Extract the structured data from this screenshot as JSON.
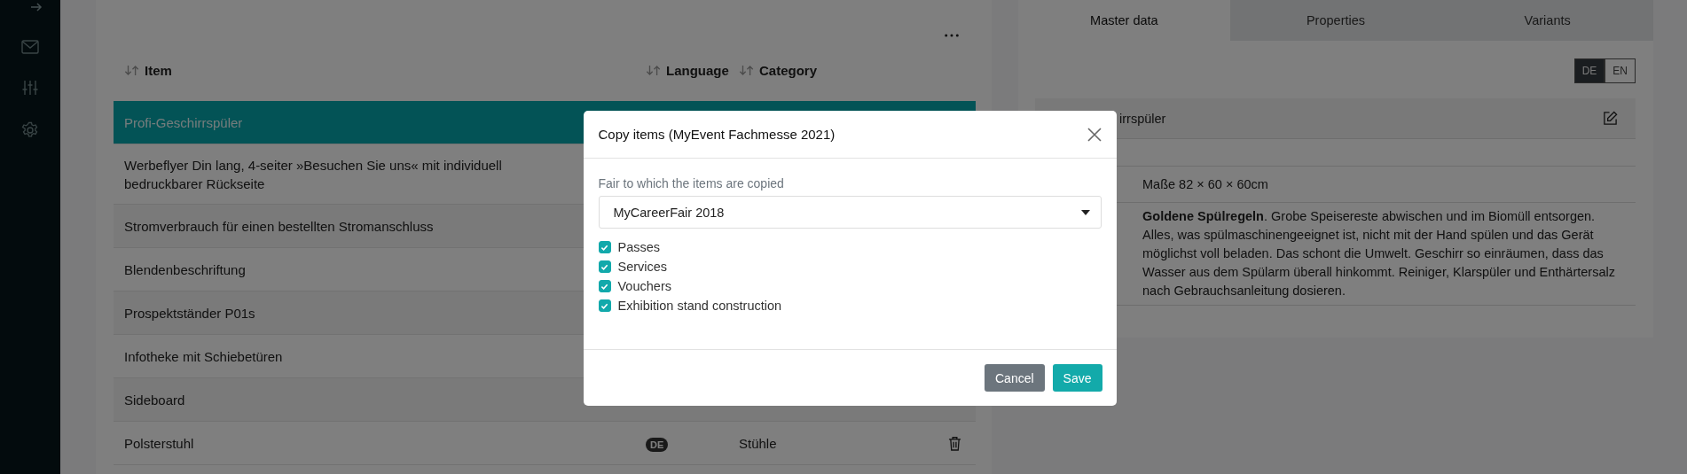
{
  "table": {
    "columns": [
      {
        "label": "Item"
      },
      {
        "label": "Language"
      },
      {
        "label": "Category"
      }
    ],
    "rows": [
      {
        "item": "Profi-Geschirrspüler",
        "selected": true
      },
      {
        "item": "Werbeflyer Din lang, 4-seiter »Besuchen Sie uns« mit individuell bedruckbarer Rückseite",
        "selected": false
      },
      {
        "item": "Stromverbrauch für einen bestellten Stromanschluss",
        "selected": false
      },
      {
        "item": "Blendenbeschriftung",
        "selected": false
      },
      {
        "item": "Prospektständer P01s",
        "selected": false
      },
      {
        "item": "Infotheke mit Schiebetüren",
        "selected": false
      },
      {
        "item": "Sideboard",
        "selected": false
      },
      {
        "item": "Polsterstuhl",
        "language": "DE",
        "category": "Stühle",
        "selected": false
      }
    ]
  },
  "detail": {
    "tabs": [
      {
        "label": "Master data",
        "selected": true
      },
      {
        "label": "Properties",
        "selected": false
      },
      {
        "label": "Variants",
        "selected": false
      }
    ],
    "languages": [
      {
        "label": "DE",
        "selected": true
      },
      {
        "label": "EN",
        "selected": false
      }
    ],
    "rows": [
      {
        "kind": "title",
        "value": "irrspüler"
      },
      {
        "kind": "blank"
      },
      {
        "kind": "text",
        "value": "Maße 82 × 60 × 60cm"
      },
      {
        "kind": "text",
        "value": "**Goldene Spülregeln**. Grobe Speisereste abwischen und im Biomüll entsorgen. Alles, was spülmaschinengeeignet ist, nicht mit der Hand spülen und das Gerät möglichst voll beladen. Das schont die Umwelt. Geschirr so einräumen, dass das Wasser aus dem Spülarm überall hinkommt. Reiniger, Klarspüler und Enthärtersalz nach Gebrauchsanleitung dosieren."
      }
    ]
  },
  "modal": {
    "title": "Copy items (MyEvent Fachmesse 2021)",
    "field_label": "Fair to which the items are copied",
    "select_value": "MyCareerFair 2018",
    "options": [
      {
        "label": "Passes",
        "checked": true
      },
      {
        "label": "Services",
        "checked": true
      },
      {
        "label": "Vouchers",
        "checked": true
      },
      {
        "label": "Exhibition stand construction",
        "checked": true
      }
    ],
    "buttons": [
      {
        "kind": "cancel",
        "label": "Cancel"
      },
      {
        "kind": "save",
        "label": "Save"
      }
    ]
  }
}
